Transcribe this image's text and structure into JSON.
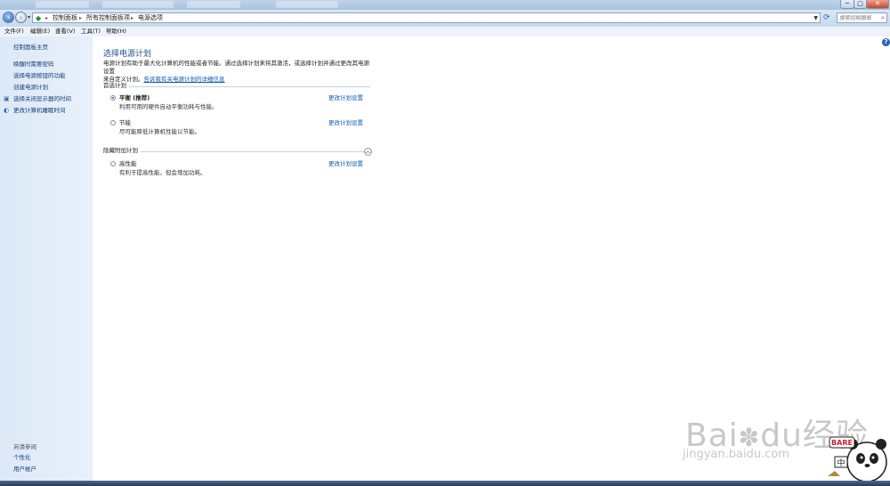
{
  "window": {
    "minimize": "─",
    "maximize": "□",
    "close": "✕"
  },
  "nav": {
    "back_icon": "back-arrow-icon",
    "forward_icon": "forward-arrow-icon",
    "breadcrumbs": [
      "控制面板",
      "所有控制面板项",
      "电源选项"
    ],
    "search_placeholder": "搜索控制面板"
  },
  "menu": [
    "文件(F)",
    "编辑(E)",
    "查看(V)",
    "工具(T)",
    "帮助(H)"
  ],
  "sidebar": {
    "items": [
      "控制面板主页",
      "唤醒时需要密码",
      "选择电源按钮的功能",
      "创建电源计划",
      "选择关闭显示器的时间",
      "更改计算机睡眠时间"
    ],
    "see_also_title": "另请参阅",
    "see_also": [
      "个性化",
      "用户帐户"
    ]
  },
  "main": {
    "title": "选择电源计划",
    "description_1": "电源计划有助于最大化计算机的性能或者节能。通过选择计划来将其激活，或选择计划并通过更改其电源设置",
    "description_2": "来自定义计划。",
    "description_link": "告诉我有关电源计划的详细信息",
    "preferred_section": "首选计划",
    "hidden_section": "隐藏附加计划",
    "change_link": "更改计划设置",
    "plans": [
      {
        "name": "平衡 (推荐)",
        "desc": "利用可用的硬件自动平衡功耗与性能。",
        "selected": true
      },
      {
        "name": "节能",
        "desc": "尽可能降低计算机性能以节能。",
        "selected": false
      },
      {
        "name": "高性能",
        "desc": "有利于提高性能，但会增加功耗。",
        "selected": false
      }
    ]
  },
  "watermark": {
    "brand": "Bai",
    "brand2": "du",
    "cn": "经验",
    "url": "jingyan.baidu.com",
    "badge": "BARE",
    "badge_cn": "中"
  },
  "colors": {
    "accent": "#1f4f91",
    "link": "#0b58b4",
    "sidebar": "#dde9f7"
  }
}
